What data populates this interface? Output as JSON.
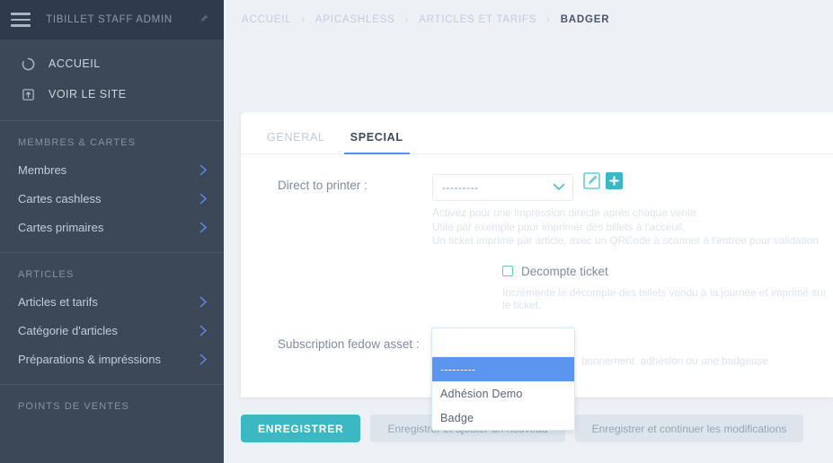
{
  "sidebar": {
    "brand": "TIBILLET STAFF ADMIN",
    "menu_icon": "hamburger-icon",
    "pin_icon": "pin-icon",
    "links": [
      {
        "label": "ACCUEIL",
        "icon": "home-spinner-icon"
      },
      {
        "label": "VOIR LE SITE",
        "icon": "external-link-icon"
      }
    ],
    "sections": [
      {
        "title": "MEMBRES & CARTES",
        "items": [
          {
            "label": "Membres",
            "icon": "chevron-right-icon"
          },
          {
            "label": "Cartes cashless",
            "icon": "chevron-right-icon"
          },
          {
            "label": "Cartes primaires",
            "icon": "chevron-right-icon"
          }
        ]
      },
      {
        "title": "ARTICLES",
        "items": [
          {
            "label": "Articles et tarifs",
            "icon": "chevron-right-icon"
          },
          {
            "label": "Catégorie d'articles",
            "icon": "chevron-right-icon"
          },
          {
            "label": "Préparations & impréssions",
            "icon": "chevron-right-icon"
          }
        ]
      },
      {
        "title": "POINTS DE VENTES",
        "items": []
      }
    ]
  },
  "breadcrumb": {
    "separator": "›",
    "items": [
      {
        "label": "ACCUEIL",
        "active": false
      },
      {
        "label": "APICASHLESS",
        "active": false
      },
      {
        "label": "ARTICLES ET TARIFS",
        "active": false
      },
      {
        "label": "BADGER",
        "active": true
      }
    ]
  },
  "tabs": [
    {
      "label": "GENERAL",
      "active": false
    },
    {
      "label": "SPECIAL",
      "active": true
    }
  ],
  "form": {
    "printer": {
      "label": "Direct to printer :",
      "value": "---------",
      "chevron_icon": "chevron-down-icon",
      "edit_icon": "edit-pencil-icon",
      "add_icon": "plus-icon",
      "help": [
        "Activez pour une impression directe après chaque vente.",
        "Utile par exemple pour imprimer des billets à l'acceuil,",
        "Un ticket imprimé par article, avec un QRCode à scanner à l'entrée pour validation"
      ]
    },
    "decompte": {
      "label": "Decompte ticket",
      "checked": false,
      "help": "Incrémente le décompte des billets vendu à la journée et imprimé sur le ticket."
    },
    "subscription": {
      "label": "Subscription fedow asset :",
      "help_visible_fragment": "bonnement, adhésion ou une badgeuse",
      "dropdown": {
        "search_value": "",
        "options": [
          {
            "label": "---------",
            "selected": true
          },
          {
            "label": "Adhésion Demo",
            "selected": false
          },
          {
            "label": "Badge",
            "selected": false
          }
        ]
      }
    }
  },
  "actions": [
    {
      "label": "ENREGISTRER",
      "style": "primary"
    },
    {
      "label": "Enregistrer et ajouter un nouveau",
      "style": "ghost"
    },
    {
      "label": "Enregistrer et continuer les modifications",
      "style": "ghost"
    }
  ],
  "colors": {
    "sidebar_bg": "#3c4858",
    "sidebar_header_bg": "#2f3b4c",
    "page_bg": "#edf1f5",
    "accent_teal": "#3cb8c4",
    "accent_blue": "#5b8def",
    "option_highlight": "#5b95ef"
  }
}
